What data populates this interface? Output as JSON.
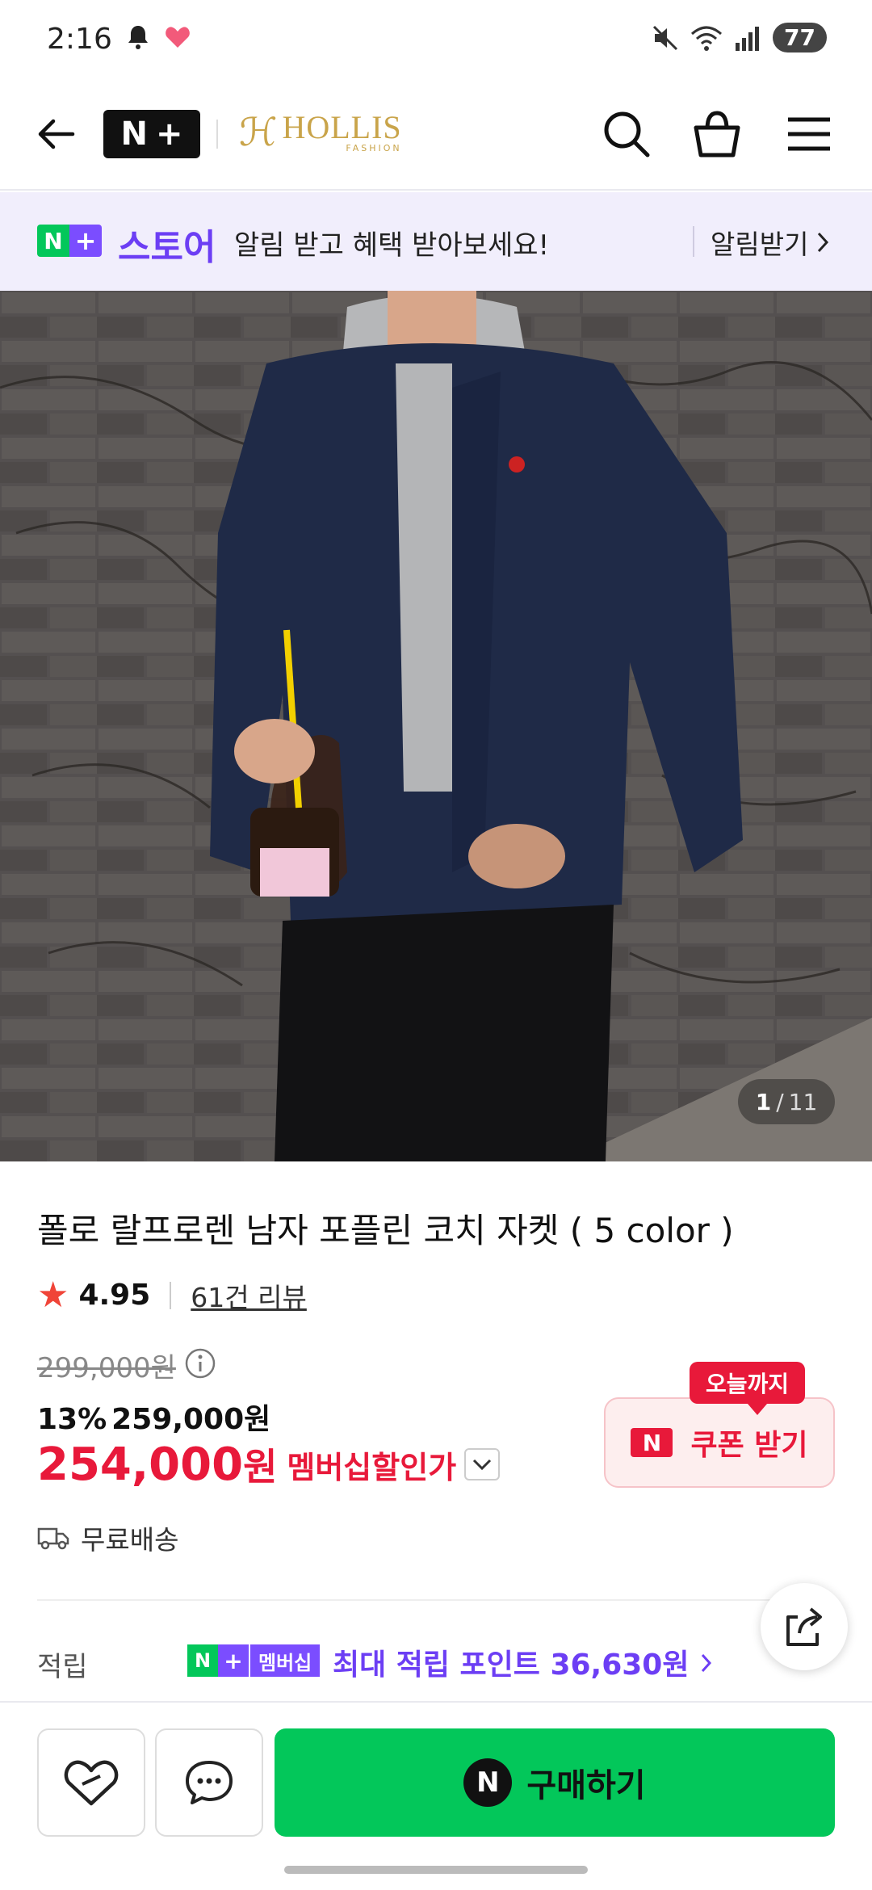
{
  "status_bar": {
    "time": "2:16",
    "battery": "77"
  },
  "nav": {
    "brand_text": "HOLLIS",
    "brand_sub": "FASHION",
    "nplus_n": "N",
    "nplus_plus": "+"
  },
  "promo": {
    "badge_n": "N",
    "badge_plus": "+",
    "store": "스토어",
    "message": "알림 받고 혜택 받아보세요!",
    "button": "알림받기"
  },
  "hero": {
    "page_current": "1",
    "page_separator": "/",
    "page_total": "11"
  },
  "product": {
    "title": "폴로 랄프로렌 남자 포플린 코치 자켓 ( 5 color )",
    "rating": "4.95",
    "reviews": "61건 리뷰",
    "original_price": "299,000원",
    "discount_percent": "13%",
    "discount_price": "259,000원",
    "member_price": "254,000",
    "member_unit": "원",
    "member_label": "멤버십할인가",
    "shipping": "무료배송"
  },
  "coupon": {
    "tag": "오늘까지",
    "badge": "N",
    "label": "쿠폰 받기"
  },
  "points": {
    "label": "적립",
    "badge_n": "N",
    "badge_plus": "+",
    "badge_membership": "멤버십",
    "text": "최대 적립 포인트 36,630원"
  },
  "bottom": {
    "buy_badge": "N",
    "buy_label": "구매하기"
  },
  "colors": {
    "accent_green": "#03c75a",
    "accent_purple": "#6c3ef4",
    "accent_red": "#e8193a"
  }
}
